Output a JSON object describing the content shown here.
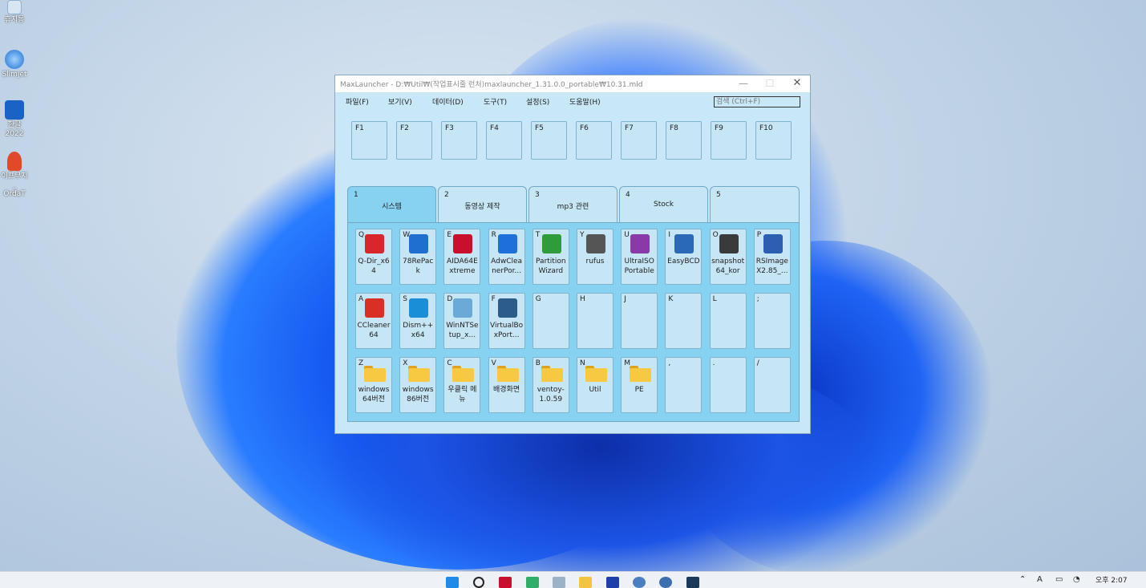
{
  "desktop": {
    "icons": [
      {
        "label": "휴지통",
        "icon": "recycle-bin-icon"
      },
      {
        "label": "Slimjet",
        "icon": "browser-icon"
      },
      {
        "label": "한글 2022",
        "icon": "hangul-icon"
      },
      {
        "label": "이프무지_\nOrdaT",
        "icon": "app-icon"
      }
    ]
  },
  "window": {
    "title": "MaxLauncher - D:₩Util₩(작업표시줄 런처)maxlauncher_1.31.0.0_portable₩10.31.mld",
    "controls": {
      "minimize": "—",
      "maximize": "☐",
      "close": "✕"
    }
  },
  "menu": {
    "items": [
      "파일(F)",
      "보기(V)",
      "데이터(D)",
      "도구(T)",
      "설정(S)",
      "도움말(H)"
    ],
    "search_placeholder": "검색 (Ctrl+F)"
  },
  "function_keys": [
    "F1",
    "F2",
    "F3",
    "F4",
    "F5",
    "F6",
    "F7",
    "F8",
    "F9",
    "F10"
  ],
  "tabs": [
    {
      "num": "1",
      "label": "시스템",
      "active": true
    },
    {
      "num": "2",
      "label": "동영상 제작",
      "active": false
    },
    {
      "num": "3",
      "label": "mp3 관련",
      "active": false
    },
    {
      "num": "4",
      "label": "Stock",
      "active": false
    },
    {
      "num": "5",
      "label": "",
      "active": false
    }
  ],
  "rows": [
    [
      {
        "key": "Q",
        "name": "Q-Dir_x64",
        "icon": "q-dir-icon",
        "color": "#d9262c"
      },
      {
        "key": "W",
        "name": "78RePack",
        "icon": "repack-icon",
        "color": "#1f6fd1"
      },
      {
        "key": "E",
        "name": "AIDA64Extreme",
        "icon": "aida64-icon",
        "color": "#c8102e"
      },
      {
        "key": "R",
        "name": "AdwCleanerPor...",
        "icon": "adwcleaner-icon",
        "color": "#1e6fd9"
      },
      {
        "key": "T",
        "name": "Partition Wizard",
        "icon": "partition-wizard-icon",
        "color": "#2e9c3a"
      },
      {
        "key": "Y",
        "name": "rufus",
        "icon": "usb-drive-icon",
        "color": "#555555"
      },
      {
        "key": "U",
        "name": "UltraISO Portable",
        "icon": "ultraiso-icon",
        "color": "#8a3aa8"
      },
      {
        "key": "I",
        "name": "EasyBCD",
        "icon": "easybcd-icon",
        "color": "#2a68b8"
      },
      {
        "key": "O",
        "name": "snapshot64_kor",
        "icon": "snapshot-icon",
        "color": "#3a3a3a"
      },
      {
        "key": "P",
        "name": "RSImageX2.85_...",
        "icon": "rsimagex-icon",
        "color": "#2d5fb0"
      }
    ],
    [
      {
        "key": "A",
        "name": "CCleaner64",
        "icon": "ccleaner-icon",
        "color": "#d93025"
      },
      {
        "key": "S",
        "name": "Dism++x64",
        "icon": "dism-icon",
        "color": "#1a8fd8"
      },
      {
        "key": "D",
        "name": "WinNTSetup_x...",
        "icon": "winntsetup-icon",
        "color": "#6aa9d8"
      },
      {
        "key": "F",
        "name": "VirtualBoxPort...",
        "icon": "virtualbox-icon",
        "color": "#2b5c8a"
      },
      {
        "key": "G",
        "name": "",
        "icon": "",
        "color": ""
      },
      {
        "key": "H",
        "name": "",
        "icon": "",
        "color": ""
      },
      {
        "key": "J",
        "name": "",
        "icon": "",
        "color": ""
      },
      {
        "key": "K",
        "name": "",
        "icon": "",
        "color": ""
      },
      {
        "key": "L",
        "name": "",
        "icon": "",
        "color": ""
      },
      {
        "key": ";",
        "name": "",
        "icon": "",
        "color": ""
      }
    ],
    [
      {
        "key": "Z",
        "name": "windows 64버전",
        "icon": "folder-icon",
        "color": ""
      },
      {
        "key": "X",
        "name": "windows 86버전",
        "icon": "folder-icon",
        "color": ""
      },
      {
        "key": "C",
        "name": "우클릭 메뉴",
        "icon": "folder-icon",
        "color": ""
      },
      {
        "key": "V",
        "name": "배경화면",
        "icon": "folder-icon",
        "color": ""
      },
      {
        "key": "B",
        "name": "ventoy-1.0.59",
        "icon": "folder-icon",
        "color": ""
      },
      {
        "key": "N",
        "name": "Util",
        "icon": "folder-icon",
        "color": ""
      },
      {
        "key": "M",
        "name": "PE",
        "icon": "folder-icon",
        "color": ""
      },
      {
        "key": ",",
        "name": "",
        "icon": "",
        "color": ""
      },
      {
        "key": ".",
        "name": "",
        "icon": "",
        "color": ""
      },
      {
        "key": "/",
        "name": "",
        "icon": "",
        "color": ""
      }
    ]
  ],
  "taskbar": {
    "clock_time": "오후 2:07",
    "ime": "A"
  }
}
